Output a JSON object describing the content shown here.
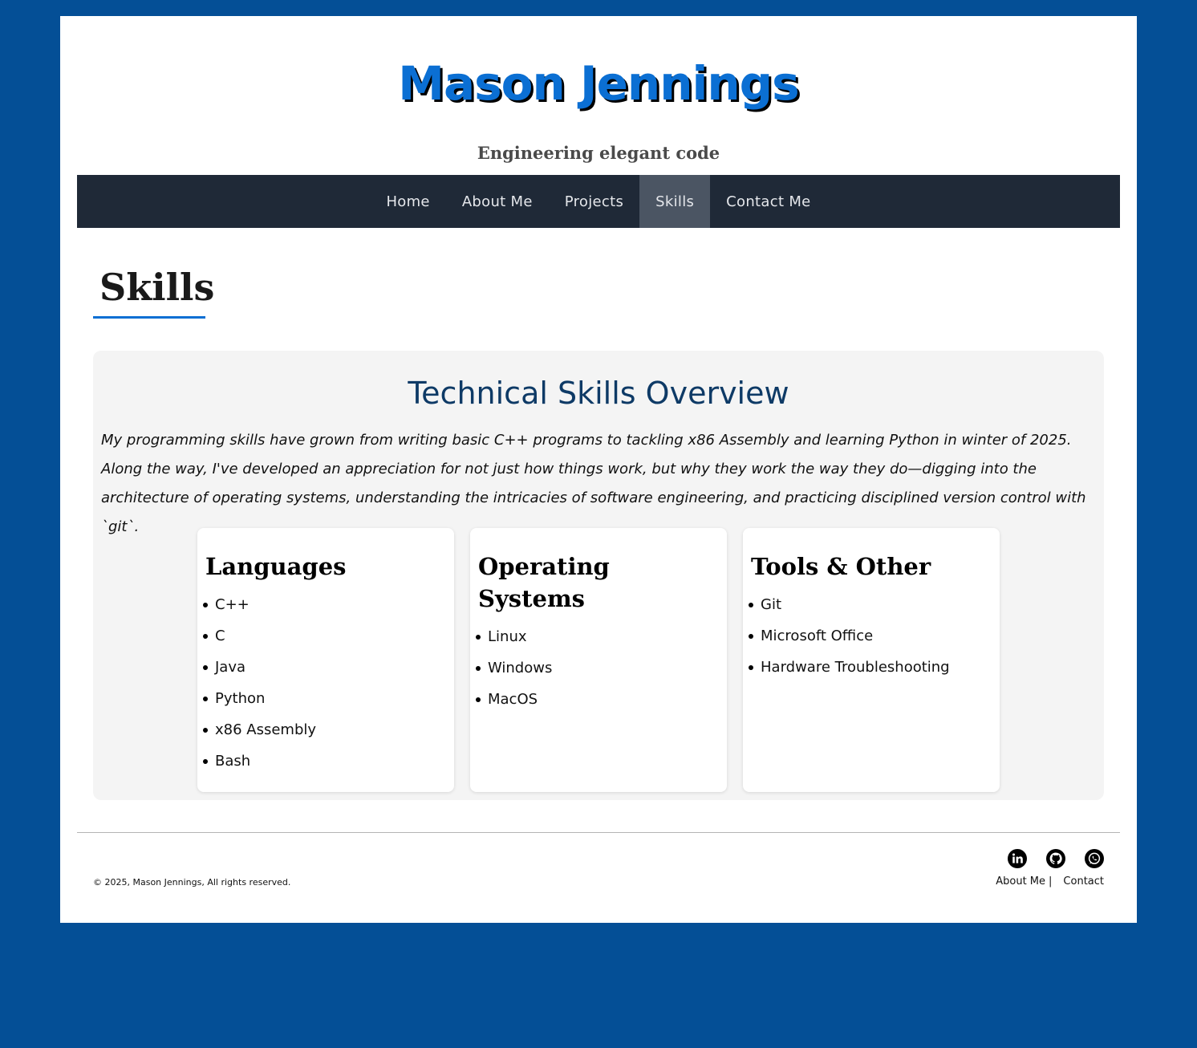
{
  "header": {
    "site_title": "Mason Jennings",
    "tagline": "Engineering elegant code"
  },
  "nav": {
    "items": [
      {
        "label": "Home",
        "active": false
      },
      {
        "label": "About Me",
        "active": false
      },
      {
        "label": "Projects",
        "active": false
      },
      {
        "label": "Skills",
        "active": true
      },
      {
        "label": "Contact Me",
        "active": false
      }
    ]
  },
  "page": {
    "heading": "Skills"
  },
  "overview": {
    "title": "Technical Skills Overview",
    "text": "My programming skills have grown from writing basic C++ programs to tackling x86 Assembly and learning Python in winter of 2025. Along the way, I've developed an appreciation for not just how things work, but why they work the way they do—digging into the architecture of operating systems, understanding the intricacies of software engineering, and practicing disciplined version control with `git`."
  },
  "cards": [
    {
      "title": "Languages",
      "items": [
        "C++",
        "C",
        "Java",
        "Python",
        "x86 Assembly",
        "Bash"
      ]
    },
    {
      "title": "Operating Systems",
      "items": [
        "Linux",
        "Windows",
        "MacOS"
      ]
    },
    {
      "title": "Tools & Other",
      "items": [
        "Git",
        "Microsoft Office",
        "Hardware Troubleshooting"
      ]
    }
  ],
  "footer": {
    "copyright": "© 2025, Mason Jennings, All rights reserved.",
    "social": [
      "linkedin-icon",
      "github-icon",
      "whatsapp-icon"
    ],
    "links": {
      "about": "About Me",
      "separator": "|",
      "contact": "Contact"
    }
  },
  "colors": {
    "background": "#044f96",
    "accent": "#0b6fd3",
    "nav_bg": "#1f2937",
    "nav_active": "#4b5563",
    "overview_title": "#0e3a66"
  }
}
